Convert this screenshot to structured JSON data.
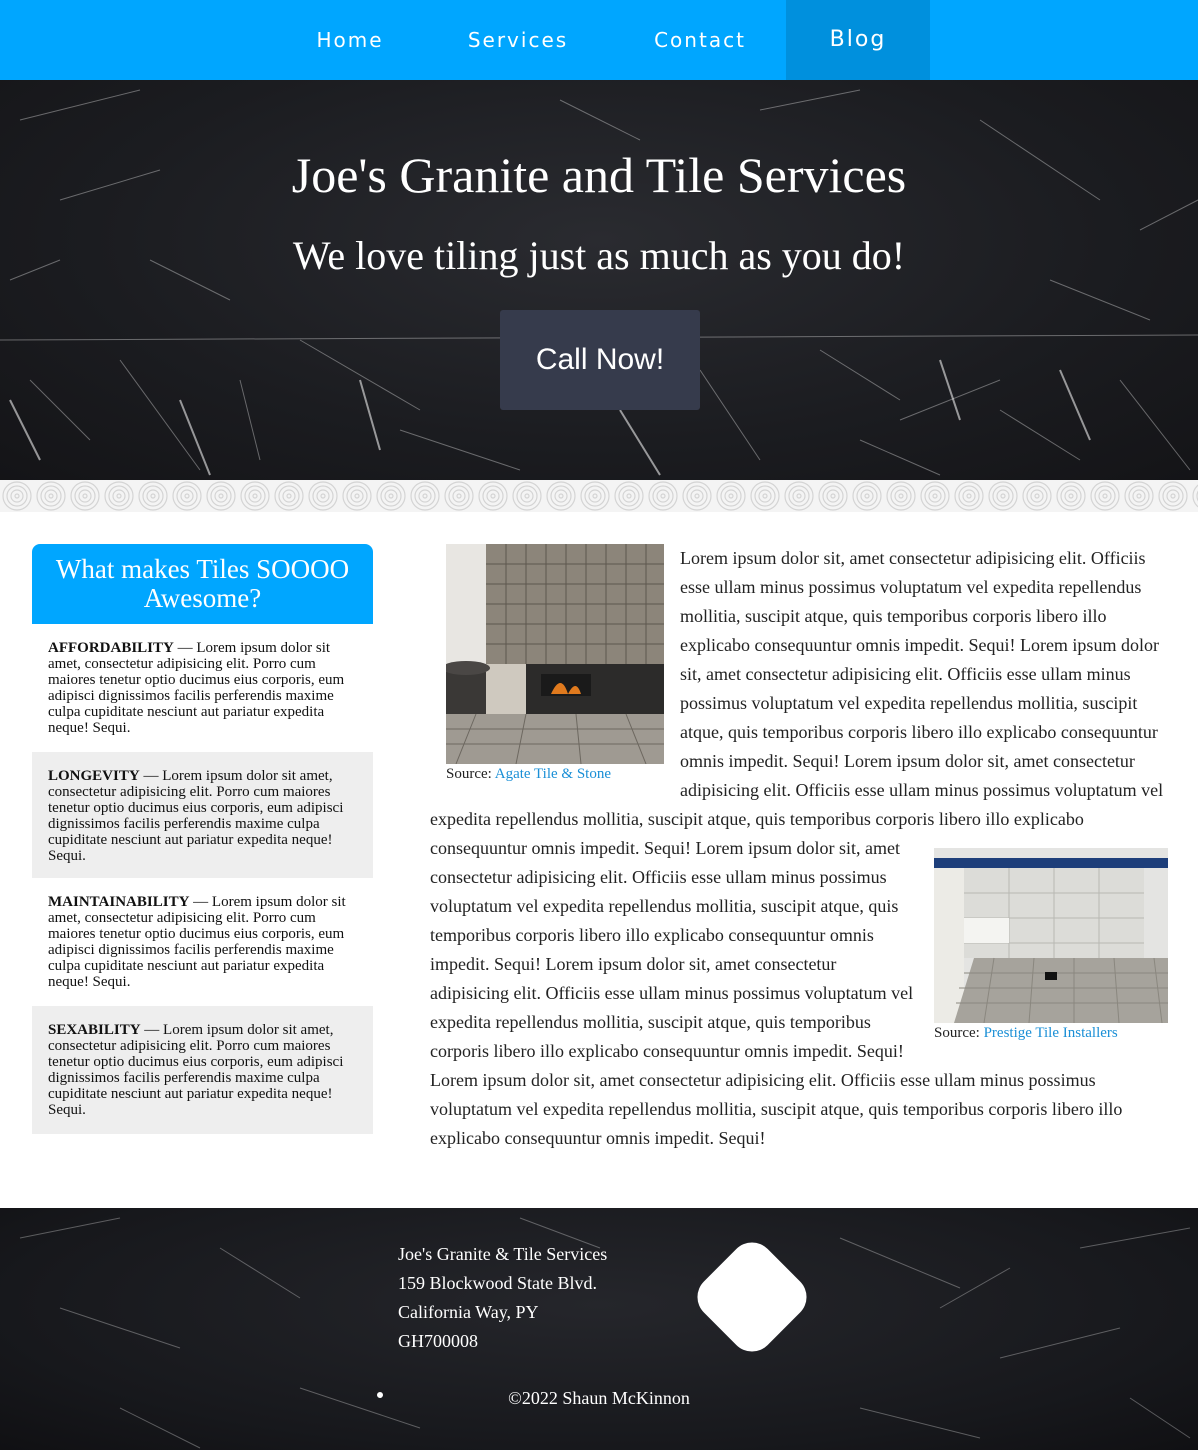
{
  "nav": {
    "items": [
      {
        "label": "Home"
      },
      {
        "label": "Services"
      },
      {
        "label": "Contact"
      },
      {
        "label": "Blog",
        "active": true
      }
    ]
  },
  "hero": {
    "title": "Joe's Granite and Tile Services",
    "subtitle": "We love tiling just as much as you do!",
    "cta_label": "Call Now!"
  },
  "sidebar": {
    "heading": "What makes Tiles SOOOO Awesome?",
    "cards": [
      {
        "term": "AFFORDABILITY",
        "text": " — Lorem ipsum dolor sit amet, consectetur adipisicing elit. Porro cum maiores tenetur optio ducimus eius corporis, eum adipisci dignissimos facilis perferendis maxime culpa cupiditate nesciunt aut pariatur expedita neque! Sequi."
      },
      {
        "term": "LONGEVITY",
        "text": " — Lorem ipsum dolor sit amet, consectetur adipisicing elit. Porro cum maiores tenetur optio ducimus eius corporis, eum adipisci dignissimos facilis perferendis maxime culpa cupiditate nesciunt aut pariatur expedita neque! Sequi."
      },
      {
        "term": "MAINTAINABILITY",
        "text": " — Lorem ipsum dolor sit amet, consectetur adipisicing elit. Porro cum maiores tenetur optio ducimus eius corporis, eum adipisci dignissimos facilis perferendis maxime culpa cupiditate nesciunt aut pariatur expedita neque! Sequi."
      },
      {
        "term": "SEXABILITY",
        "text": " — Lorem ipsum dolor sit amet, consectetur adipisicing elit. Porro cum maiores tenetur optio ducimus eius corporis, eum adipisci dignissimos facilis perferendis maxime culpa cupiditate nesciunt aut pariatur expedita neque! Sequi."
      }
    ]
  },
  "article": {
    "figure1": {
      "source_prefix": "Source: ",
      "source_link": "Agate Tile & Stone"
    },
    "figure2": {
      "source_prefix": "Source: ",
      "source_link": "Prestige Tile Installers"
    },
    "paragraph": "Lorem ipsum dolor sit, amet consectetur adipisicing elit. Officiis esse ullam minus possimus voluptatum vel expedita repellendus mollitia, suscipit atque, quis temporibus corporis libero illo explicabo consequuntur omnis impedit. Sequi!"
  },
  "footer": {
    "address_lines": [
      "Joe's Granite & Tile Services",
      "159 Blockwood State Blvd.",
      "California Way, PY",
      "GH700008"
    ],
    "copyright": "©2022 Shaun McKinnon"
  },
  "colors": {
    "nav": "#00a6ff",
    "nav_active": "#0090dd",
    "cta": "#363b4c",
    "link": "#1a8fd6"
  }
}
